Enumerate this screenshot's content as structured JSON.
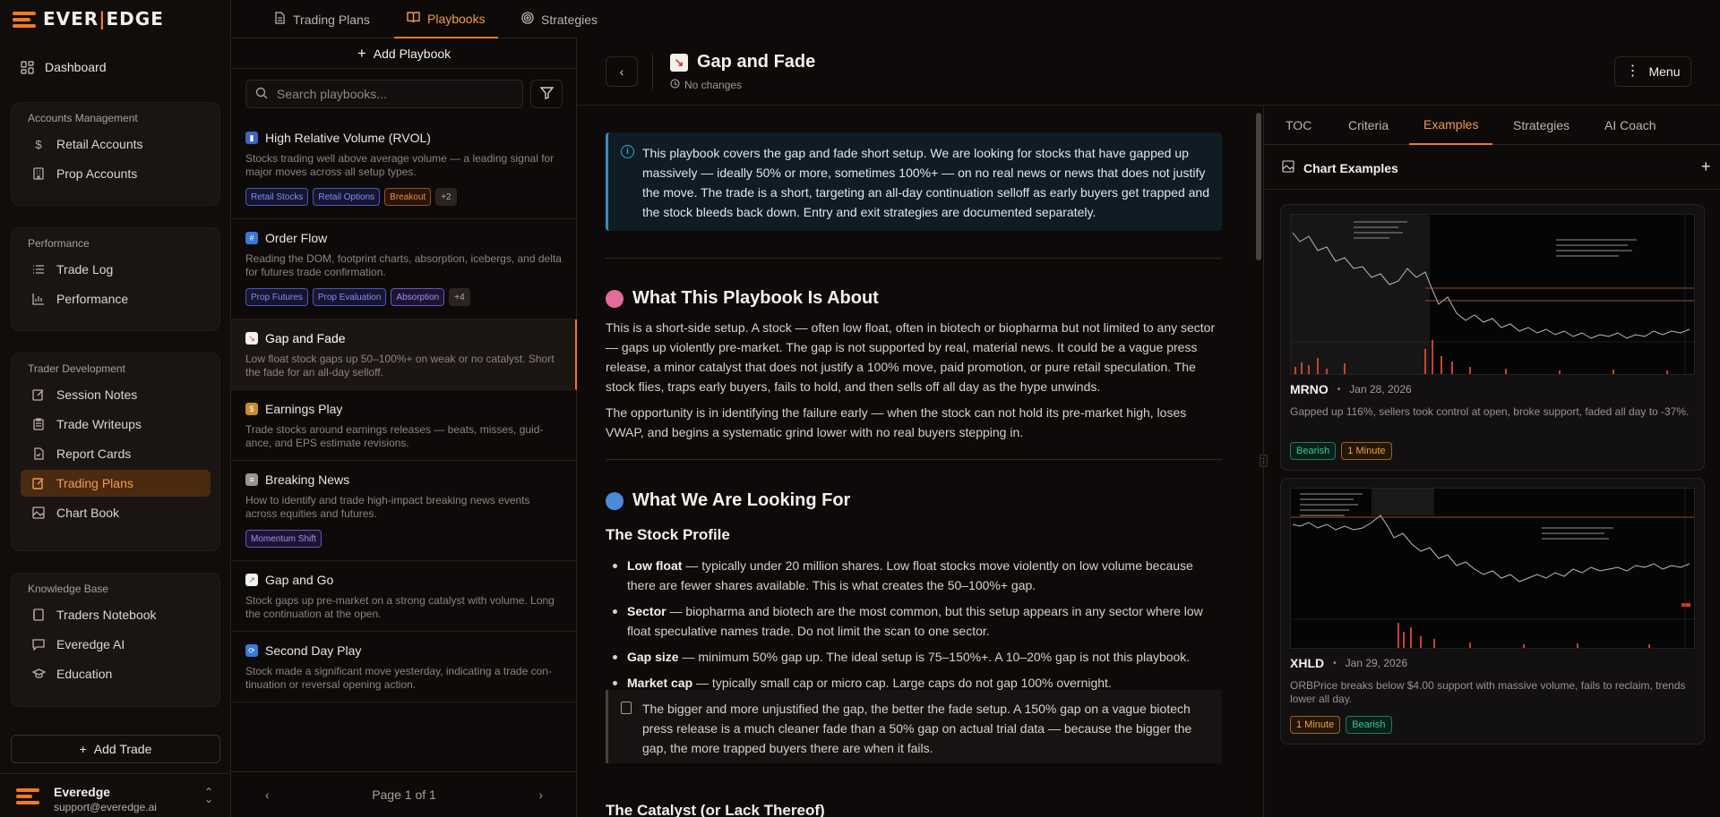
{
  "app": {
    "logo_left": "EVER",
    "logo_right": "EDGE",
    "logo_sep": "|"
  },
  "sidebar": {
    "dashboard": "Dashboard",
    "groups": [
      {
        "title": "Accounts Management",
        "items": [
          "Retail Accounts",
          "Prop Accounts"
        ]
      },
      {
        "title": "Performance",
        "items": [
          "Trade Log",
          "Performance"
        ]
      },
      {
        "title": "Trader Development",
        "items": [
          "Session Notes",
          "Trade Writeups",
          "Report Cards",
          "Trading Plans",
          "Chart Book"
        ]
      },
      {
        "title": "Knowledge Base",
        "items": [
          "Traders Notebook",
          "Everedge AI",
          "Education"
        ]
      }
    ],
    "add_trade": "Add Trade",
    "user": {
      "name": "Everedge",
      "email": "support@everedge.ai"
    }
  },
  "top_tabs": [
    "Trading Plans",
    "Playbooks",
    "Strategies"
  ],
  "list": {
    "add_label": "Add Playbook",
    "search_placeholder": "Search playbooks...",
    "items": [
      {
        "title": "High Relative Volume (RVOL)",
        "desc": "Stocks trading well above average volume — a leading signal for major moves across all setup types.",
        "tags": [
          "Retail Stocks",
          "Retail Options",
          "Breakout",
          "+2"
        ]
      },
      {
        "title": "Order Flow",
        "desc": "Reading the DOM, footprint charts, absorption, icebergs, and delta for futures trade confirmation.",
        "tags": [
          "Prop Futures",
          "Prop Evaluation",
          "Absorption",
          "+4"
        ]
      },
      {
        "title": "Gap and Fade",
        "desc": "Low float stock gaps up 50–100%+ on weak or no catalyst. Short the fade for an all-day selloff.",
        "tags": []
      },
      {
        "title": "Earnings Play",
        "desc": "Trade stocks around earnings releases — beats, misses, guid­ance, and EPS estimate revisions.",
        "tags": []
      },
      {
        "title": "Breaking News",
        "desc": "How to identify and trade high-impact breaking news events across equities and futures.",
        "tags": [
          "Momentum Shift"
        ]
      },
      {
        "title": "Gap and Go",
        "desc": "Stock gaps up pre-market on a strong catalyst with volume. Long the continuation at the open.",
        "tags": []
      },
      {
        "title": "Second Day Play",
        "desc": "Stock made a significant move yesterday, indicating a trade con­tinuation or reversal opening action.",
        "tags": []
      }
    ],
    "pager": "Page 1 of 1"
  },
  "doc": {
    "title": "Gap and Fade",
    "status": "No changes",
    "menu": "Menu",
    "info": "This playbook covers the gap and fade short setup. We are looking for stocks that have gapped up massively — ideally 50% or more, sometimes 100%+ — on no real news or news that does not justify the move. The trade is a short, targeting an all-day continuation selloff as early buyers get trapped and the stock bleeds back down. Entry and exit strategies are documented separately.",
    "h_about": "What This Playbook Is About",
    "p_about_1": "This is a short-side setup. A stock — often low float, often in biotech or biopharma but not limited to any sector — gaps up violently pre-market. The gap is not supported by real, material news. It could be a vague press release, a minor catalyst that does not justify a 100% move, paid promotion, or pure retail speculation. The stock flies, traps early buyers, fails to hold, and then sells off all day as the hype unwinds.",
    "p_about_2": "The opportunity is in identifying the failure early — when the stock can not hold its pre-market high, loses VWAP, and begins a systematic grind lower with no real buyers stepping in.",
    "h_looking": "What We Are Looking For",
    "h_profile": "The Stock Profile",
    "bullets": [
      {
        "k": "Low float",
        "v": " — typically under 20 million shares. Low float stocks move violently on low volume because there are fewer shares available. This is what creates the 50–100%+ gap."
      },
      {
        "k": "Sector",
        "v": " — biopharma and biotech are the most common, but this setup appears in any sector where low float speculative names trade. Do not limit the scan to one sector."
      },
      {
        "k": "Gap size",
        "v": " — minimum 50% gap up. The ideal setup is 75–150%+. A 10–20% gap is not this playbook."
      },
      {
        "k": "Market cap",
        "v": " — typically small cap or micro cap. Large caps do not gap 100% overnight."
      }
    ],
    "quote": "The bigger and more unjustified the gap, the better the fade setup. A 150% gap on a vague biotech press release is a much cleaner fade than a 50% gap on actual trial data — because the bigger the gap, the more trapped buyers there are when it fails.",
    "h_catalyst": "The Catalyst (or Lack Thereof)"
  },
  "right": {
    "tabs": [
      "TOC",
      "Criteria",
      "Examples",
      "Strategies",
      "AI Coach"
    ],
    "section_title": "Chart Examples",
    "examples": [
      {
        "ticker": "MRNO",
        "date": "Jan 28, 2026",
        "desc": "Gapped up 116%, sellers took control at open, broke support, faded all day to -37%.",
        "tags": [
          "Bearish",
          "1 Minute"
        ]
      },
      {
        "ticker": "XHLD",
        "date": "Jan 29, 2026",
        "desc": "ORBPrice breaks below $4.00 support with massive volume, fails to reclaim, trends lower all day.",
        "tags": [
          "1 Minute",
          "Bearish"
        ]
      }
    ]
  },
  "colors": {
    "accent": "#f07a22",
    "bg": "#0d0a09",
    "info": "#2d8fc5",
    "bearish": "#35c7a0",
    "timeframe": "#f0a23c"
  }
}
